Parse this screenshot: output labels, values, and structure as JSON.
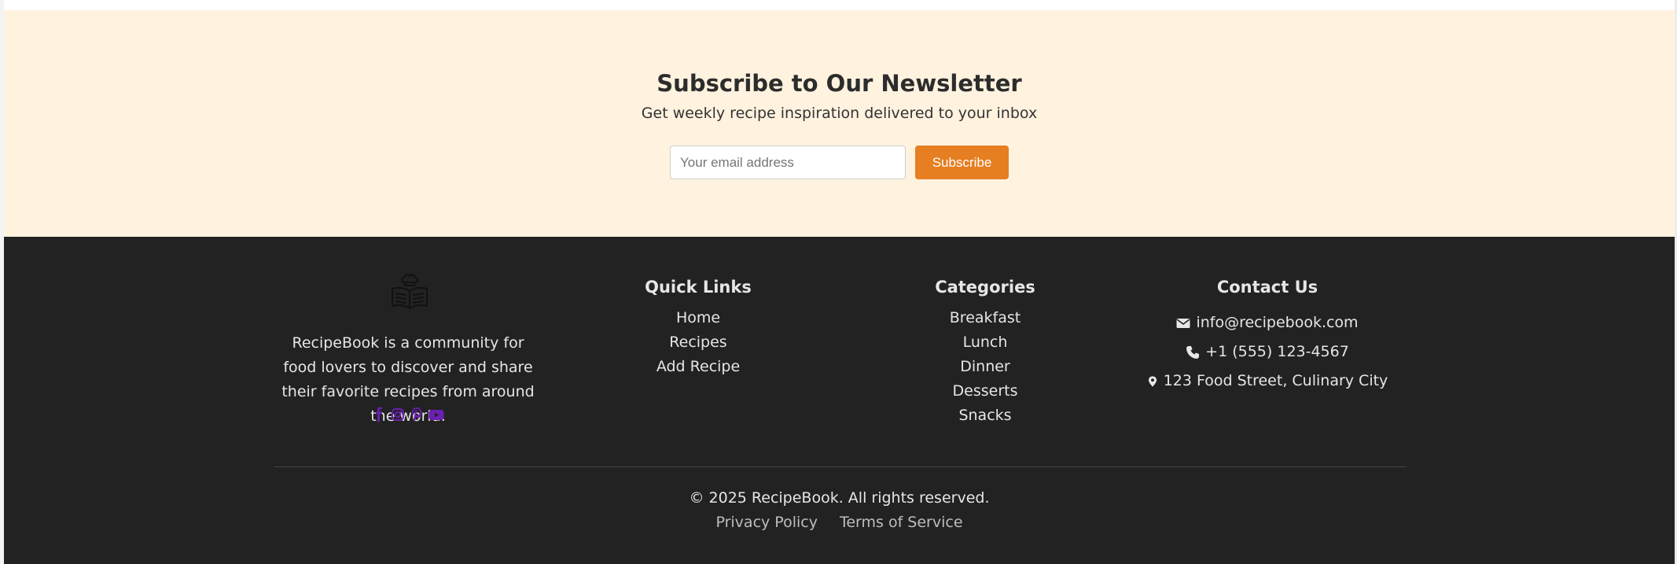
{
  "newsletter": {
    "title": "Subscribe to Our Newsletter",
    "subtitle": "Get weekly recipe inspiration delivered to your inbox",
    "email_placeholder": "Your email address",
    "subscribe_label": "Subscribe",
    "background": "#fff2df",
    "accent": "#e67e22"
  },
  "footer": {
    "background": "#222222",
    "about": {
      "logo_icon": "recipe-book-chef-icon",
      "text": "RecipeBook is a community for food lovers to discover and share their favorite recipes from around the world.",
      "socials": [
        {
          "name": "facebook-icon"
        },
        {
          "name": "instagram-icon"
        },
        {
          "name": "pinterest-icon"
        },
        {
          "name": "youtube-icon"
        }
      ],
      "social_color": "#6a1fb0"
    },
    "quick_links": {
      "title": "Quick Links",
      "items": [
        "Home",
        "Recipes",
        "Add Recipe"
      ]
    },
    "categories": {
      "title": "Categories",
      "items": [
        "Breakfast",
        "Lunch",
        "Dinner",
        "Desserts",
        "Snacks"
      ]
    },
    "contact": {
      "title": "Contact Us",
      "email": "info@recipebook.com",
      "phone": "+1 (555) 123-4567",
      "address": "123 Food Street, Culinary City"
    },
    "copyright": "© 2025 RecipeBook. All rights reserved.",
    "legal": {
      "privacy": "Privacy Policy",
      "terms": "Terms of Service"
    }
  }
}
